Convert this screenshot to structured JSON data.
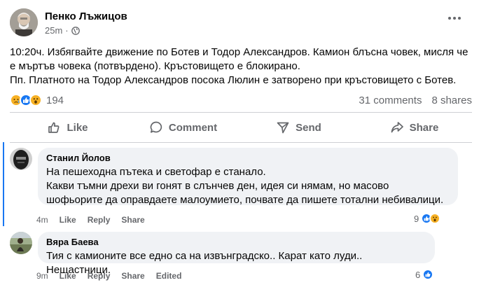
{
  "post": {
    "author": "Пенко Лъжицов",
    "time": "25m",
    "separator": "·",
    "lines": [
      "10:20ч. Избягвайте движение по Ботев и Тодор Александров. Камион блъсна човек, мисля че",
      "е мъртъв човека (потвърдено). Кръстовището е блокирано.",
      "Пп. Платното на Тодор Александров посока Люлин е затворено при кръстовището с Ботев."
    ],
    "reaction_count": "194",
    "comments_count": "31 comments",
    "shares_count": "8 shares",
    "reaction_icons": [
      "sad-icon",
      "like-icon",
      "wow-icon"
    ]
  },
  "actions": {
    "like": "Like",
    "comment": "Comment",
    "send": "Send",
    "share": "Share"
  },
  "comments": [
    {
      "name": "Станил Йолов",
      "lines": [
        "На пешеходна пътека и светофар е станало.",
        "Какви тъмни дрехи ви гонят в слънчев ден, идея си нямам, но масово",
        "шофьорите да оправдаете малоумието, почвате да пишете тотални небивалици."
      ],
      "time": "4m",
      "like": "Like",
      "reply": "Reply",
      "share": "Share",
      "reaction_count": "9"
    },
    {
      "name": "Вяра Баева",
      "lines": [
        "Тия с камионите все едно са на извънградско.. Карат като луди.. Нещастници."
      ],
      "time": "9m",
      "like": "Like",
      "reply": "Reply",
      "share": "Share",
      "edited": "Edited",
      "reaction_count": "6"
    }
  ],
  "colors": {
    "like_blue": "#1877f2",
    "reaction_yellow": "#f7b125",
    "secondary_text": "#65676b",
    "bubble_bg": "#f0f2f5"
  }
}
